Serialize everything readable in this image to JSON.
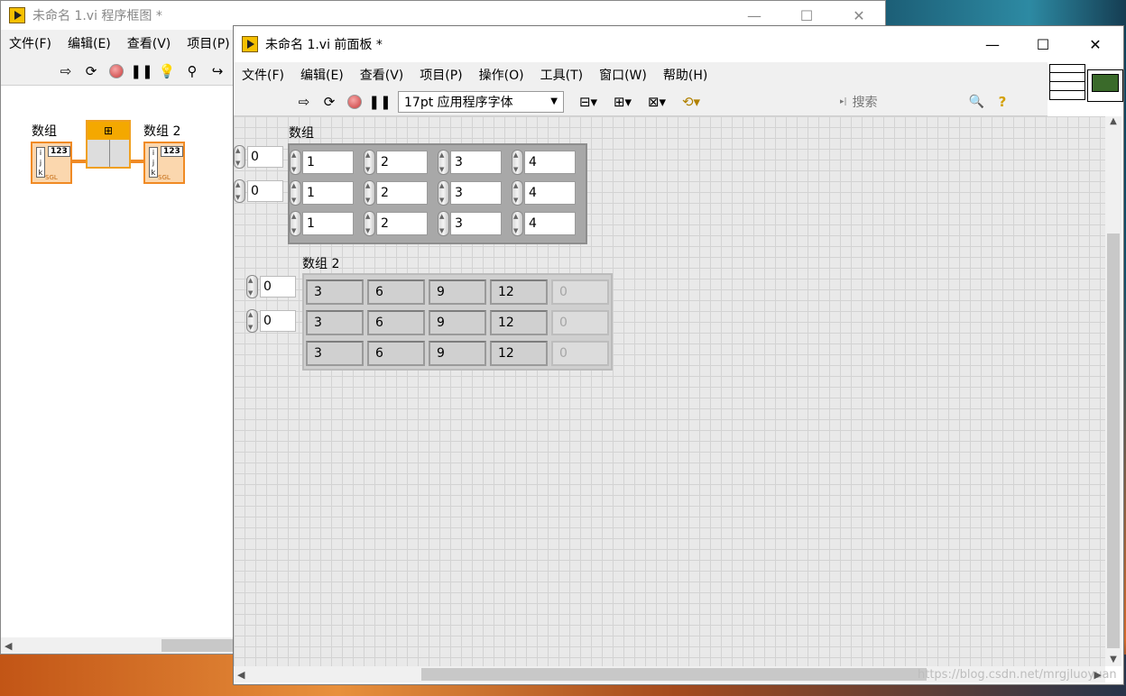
{
  "diagram_window": {
    "title": "未命名 1.vi 程序框图 *",
    "menu": [
      "文件(F)",
      "编辑(E)",
      "查看(V)",
      "项目(P)"
    ],
    "nodes": {
      "input_label": "数组",
      "output_label": "数组 2",
      "terminal_text": "123",
      "terminal_type": "SGL"
    }
  },
  "front_panel": {
    "title": "未命名 1.vi 前面板 *",
    "menu": [
      "文件(F)",
      "编辑(E)",
      "查看(V)",
      "项目(P)",
      "操作(O)",
      "工具(T)",
      "窗口(W)",
      "帮助(H)"
    ],
    "font_selector": "17pt 应用程序字体",
    "search_placeholder": "搜索",
    "array1": {
      "label": "数组",
      "index": [
        "0",
        "0"
      ],
      "rows": [
        [
          "1",
          "2",
          "3",
          "4"
        ],
        [
          "1",
          "2",
          "3",
          "4"
        ],
        [
          "1",
          "2",
          "3",
          "4"
        ]
      ]
    },
    "array2": {
      "label": "数组 2",
      "index": [
        "0",
        "0"
      ],
      "rows": [
        [
          "3",
          "6",
          "9",
          "12",
          "0"
        ],
        [
          "3",
          "6",
          "9",
          "12",
          "0"
        ],
        [
          "3",
          "6",
          "9",
          "12",
          "0"
        ]
      ]
    }
  },
  "watermark": "https://blog.csdn.net/mrgjluoyuan",
  "colors": {
    "node_orange": "#f08a24",
    "grid": "#e9e9e9",
    "accent_red": "#c83a3a"
  }
}
